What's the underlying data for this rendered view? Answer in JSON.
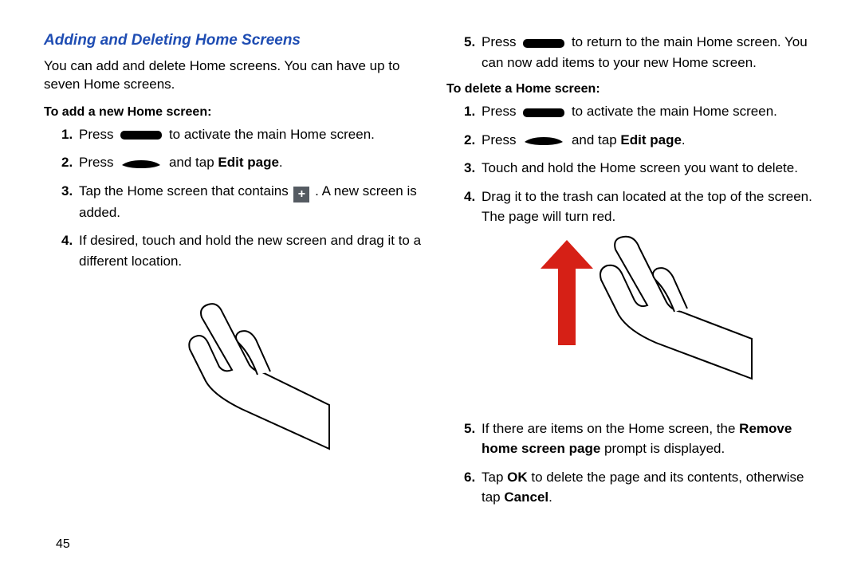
{
  "title": "Adding and Deleting Home Screens",
  "intro": "You can add and delete Home screens. You can have up to seven Home screens.",
  "addSection": {
    "heading": "To add a new Home screen:",
    "steps": {
      "s1_a": "Press",
      "s1_b": "to activate the main Home screen.",
      "s2_a": "Press",
      "s2_b": "and tap",
      "s2_c": "Edit page",
      "s3_a": "Tap the Home screen that contains",
      "s3_b": ". A new screen is added.",
      "s4": "If desired, touch and hold the new screen and drag it to a different location.",
      "s5_a": "Press",
      "s5_b": "to return to the main Home screen. You can now add items to your new Home screen."
    }
  },
  "deleteSection": {
    "heading": "To delete a Home screen:",
    "steps": {
      "s1_a": "Press",
      "s1_b": "to activate the main Home screen.",
      "s2_a": "Press",
      "s2_b": "and tap",
      "s2_c": "Edit page",
      "s3": "Touch and hold the Home screen you want to delete.",
      "s4": "Drag it to the trash can located at the top of the screen. The page will turn red.",
      "s5_a": "If there are items on the Home screen, the",
      "s5_b": "Remove home screen page",
      "s5_c": "prompt is displayed.",
      "s6_a": "Tap",
      "s6_b": "OK",
      "s6_c": "to delete the page and its contents, otherwise tap",
      "s6_d": "Cancel"
    }
  },
  "pageNumber": "45"
}
